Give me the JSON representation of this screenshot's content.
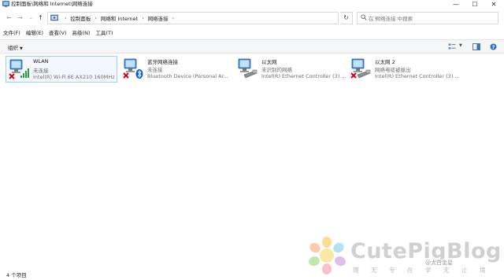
{
  "window": {
    "title": "控制面板\\网络和 Internet\\网络连接",
    "min_symbol": "—",
    "max_symbol": "☐",
    "close_symbol": "✕"
  },
  "nav": {
    "back_symbol": "←",
    "forward_symbol": "→",
    "recent_symbol": "⌄",
    "up_symbol": "↑"
  },
  "address": {
    "crumbs": [
      "控制面板",
      "网络和 Internet",
      "网络连接"
    ],
    "crumb_separator": "›",
    "refresh_symbol": "↻"
  },
  "search": {
    "placeholder": "在 网络连接 中搜索"
  },
  "menu": [
    {
      "label": "文件(F)"
    },
    {
      "label": "编辑(E)"
    },
    {
      "label": "查看(V)"
    },
    {
      "label": "高级(N)"
    },
    {
      "label": "工具(T)"
    }
  ],
  "toolbar": {
    "organize_label": "组织",
    "organize_arrow": "▼"
  },
  "connections": [
    {
      "name": "WLAN",
      "status": "未连接",
      "device": "Intel(R) Wi-Fi 6E AX210 160MHz",
      "type": "wifi",
      "selected": true
    },
    {
      "name": "蓝牙网络连接",
      "status": "未连接",
      "device": "Bluetooth Device (Personal Ar...",
      "type": "bluetooth",
      "selected": false
    },
    {
      "name": "以太网",
      "status": "未识别的网络",
      "device": "Intel(R) Ethernet Controller (3) ...",
      "type": "ethernet",
      "selected": false
    },
    {
      "name": "以太网 2",
      "status": "网络电缆被拔出",
      "device": "Intel(R) Ethernet Controller (3) ...",
      "type": "ethernet-disconnected",
      "selected": false
    }
  ],
  "statusbar": {
    "count": "4 个项目"
  },
  "watermark": {
    "brand": "CutePigBlog",
    "slogan": "理无专在学无止境",
    "handle": "@太白金星"
  },
  "colors": {
    "selection_border": "#99d1ff",
    "selection_fill": "#f2f8fe",
    "error_red": "#d0021b",
    "signal_green": "#2e9e3a",
    "bluetooth_blue": "#0a5bd1"
  },
  "icons": {
    "app": "network-connections-icon",
    "wifi": "wlan-adapter-icon",
    "bluetooth": "bluetooth-adapter-icon",
    "ethernet": "ethernet-adapter-icon"
  }
}
